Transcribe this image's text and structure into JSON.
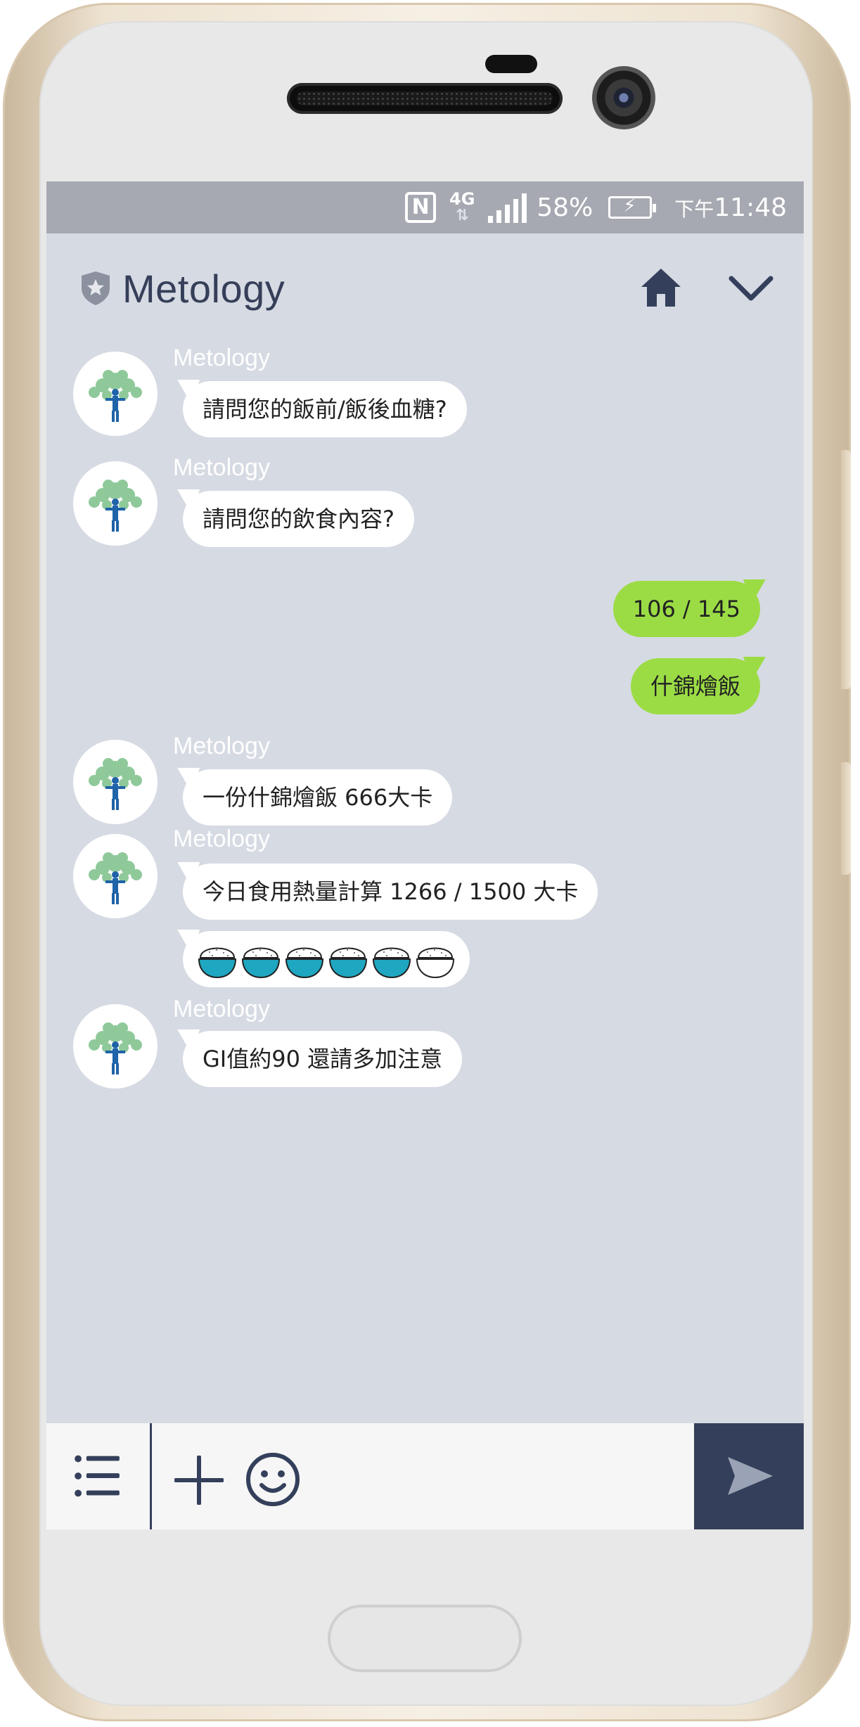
{
  "statusbar": {
    "network": "4G",
    "battery": "58%",
    "time_prefix": "下午",
    "time": "11:48",
    "nfc": "N"
  },
  "header": {
    "title": "Metology"
  },
  "messages": [
    {
      "type": "incoming",
      "sender": "Metology",
      "text": "請問您的飯前/飯後血糖?"
    },
    {
      "type": "incoming",
      "sender": "Metology",
      "text": "請問您的飲食內容?"
    },
    {
      "type": "outgoing",
      "text": "106 / 145"
    },
    {
      "type": "outgoing",
      "text": "什錦燴飯"
    },
    {
      "type": "incoming",
      "sender": "Metology",
      "text": "一份什錦燴飯 666大卡"
    },
    {
      "type": "incoming",
      "sender": "Metology",
      "text": "今日食用熱量計算 1266 / 1500 大卡"
    },
    {
      "type": "incoming-graphic",
      "bowls_total": 6,
      "bowls_filled": 5
    },
    {
      "type": "incoming",
      "sender": "Metology",
      "text": "GI值約90 還請多加注意"
    }
  ],
  "colors": {
    "screen_bg": "#d6dae3",
    "statusbar_bg": "#a6a9b1",
    "accent_dark": "#34405b",
    "outgoing_bubble": "#9bdc45",
    "bowl_fill": "#1fa6c0"
  },
  "icons": {
    "header_left": "shield-star-icon",
    "home": "home-icon",
    "collapse": "chevron-down-icon",
    "menu": "list-menu-icon",
    "add": "plus-icon",
    "emoji": "smiley-icon",
    "send": "send-arrow-icon"
  }
}
